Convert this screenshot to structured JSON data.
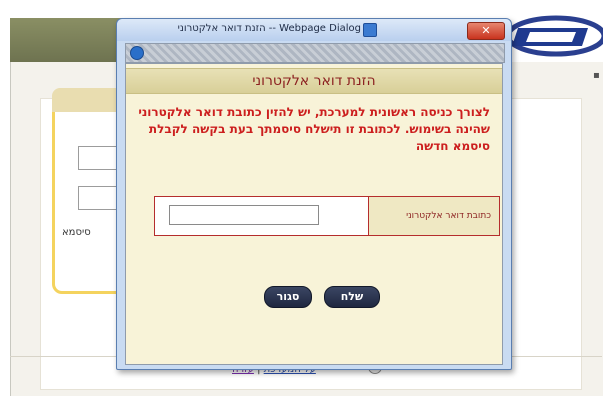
{
  "background": {
    "password_label": "סיסמא",
    "right_mark": "▪",
    "footer": {
      "about_link": "על המערכת",
      "help_link": "עזרה",
      "separator": "|",
      "icon": "info-icon"
    }
  },
  "dialog": {
    "title": "הזנת דואר אלקטרוני -- Webpage Dialog",
    "close_label": "✕",
    "header": "הזנת דואר אלקטרוני",
    "message": "לצורך כניסה ראשונית למערכת, יש להזין כתובת דואר אלקטרוני שהינה בשימוש. לכתובת זו תישלח סיסמתך בעת בקשה לקבלת סיסמא חדשה",
    "email_label": "כתובת דואר אלקטרוני",
    "email_value": "",
    "send_button": "שלח",
    "close_button": "סגור"
  },
  "colors": {
    "accent_red": "#cc1e1e",
    "button_dark": "#1f2740",
    "header_olive": "#6e7350"
  }
}
